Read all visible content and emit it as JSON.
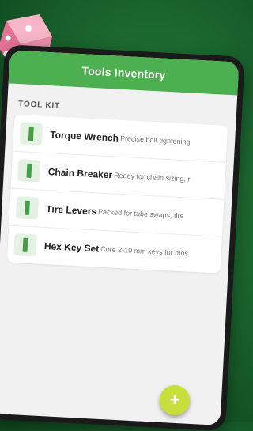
{
  "header": {
    "title": "Tools Inventory"
  },
  "section": {
    "label": "TOOL KIT"
  },
  "items": [
    {
      "title": "Torque Wrench",
      "desc": "Precise bolt tightening"
    },
    {
      "title": "Chain Breaker",
      "desc": "Ready for chain sizing, r"
    },
    {
      "title": "Tire Levers",
      "desc": "Packed for tube swaps, tire"
    },
    {
      "title": "Hex Key Set",
      "desc": "Core 2-10 mm keys for mos"
    }
  ],
  "fab": {
    "label": "+"
  },
  "colors": {
    "appbar": "#4caf50",
    "fab": "#c6df3a",
    "background": "#1d6a31"
  }
}
